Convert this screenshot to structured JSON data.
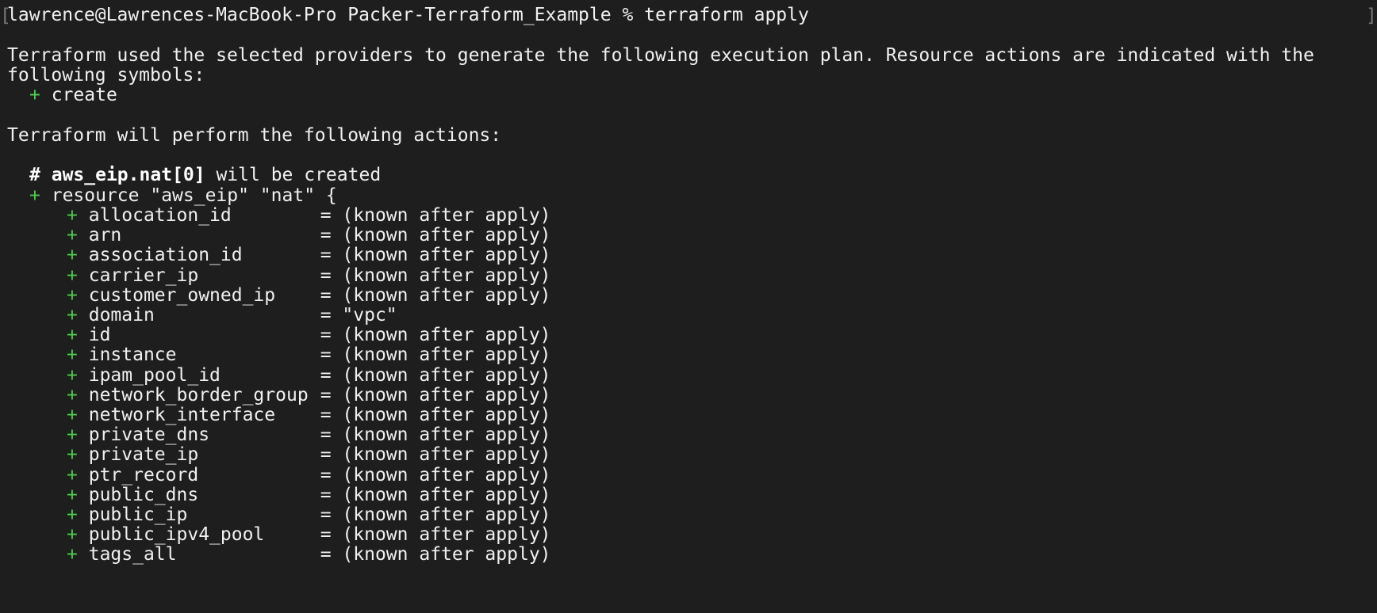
{
  "terminal": {
    "prompt": "lawrence@Lawrences-MacBook-Pro Packer-Terraform_Example % terraform apply",
    "intro_line1": "Terraform used the selected providers to generate the following execution plan. Resource actions are indicated with the",
    "intro_line2": "following symbols:",
    "legend_symbol": "+",
    "legend_label": "create",
    "actions_heading": "Terraform will perform the following actions:",
    "resource_comment_hash": "#",
    "resource_comment_name": "aws_eip.nat[0]",
    "resource_comment_suffix": "will be created",
    "resource_decl_symbol": "+",
    "resource_decl": "resource \"aws_eip\" \"nat\" {",
    "attributes": [
      {
        "symbol": "+",
        "name": "allocation_id",
        "value": "= (known after apply)"
      },
      {
        "symbol": "+",
        "name": "arn",
        "value": "= (known after apply)"
      },
      {
        "symbol": "+",
        "name": "association_id",
        "value": "= (known after apply)"
      },
      {
        "symbol": "+",
        "name": "carrier_ip",
        "value": "= (known after apply)"
      },
      {
        "symbol": "+",
        "name": "customer_owned_ip",
        "value": "= (known after apply)"
      },
      {
        "symbol": "+",
        "name": "domain",
        "value": "= \"vpc\""
      },
      {
        "symbol": "+",
        "name": "id",
        "value": "= (known after apply)"
      },
      {
        "symbol": "+",
        "name": "instance",
        "value": "= (known after apply)"
      },
      {
        "symbol": "+",
        "name": "ipam_pool_id",
        "value": "= (known after apply)"
      },
      {
        "symbol": "+",
        "name": "network_border_group",
        "value": "= (known after apply)"
      },
      {
        "symbol": "+",
        "name": "network_interface",
        "value": "= (known after apply)"
      },
      {
        "symbol": "+",
        "name": "private_dns",
        "value": "= (known after apply)"
      },
      {
        "symbol": "+",
        "name": "private_ip",
        "value": "= (known after apply)"
      },
      {
        "symbol": "+",
        "name": "ptr_record",
        "value": "= (known after apply)"
      },
      {
        "symbol": "+",
        "name": "public_dns",
        "value": "= (known after apply)"
      },
      {
        "symbol": "+",
        "name": "public_ip",
        "value": "= (known after apply)"
      },
      {
        "symbol": "+",
        "name": "public_ipv4_pool",
        "value": "= (known after apply)"
      },
      {
        "symbol": "+",
        "name": "tags_all",
        "value": "= (known after apply)"
      }
    ]
  },
  "colors": {
    "background": "#1e1e1e",
    "text": "#f0f0f0",
    "plus": "#4ec94e"
  }
}
